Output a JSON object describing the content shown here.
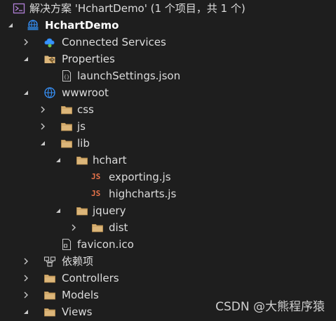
{
  "solution": {
    "title": "解决方案 'HchartDemo' (1 个项目，共 1 个)"
  },
  "project": {
    "name": "HchartDemo"
  },
  "items": {
    "connected_services": "Connected Services",
    "properties": "Properties",
    "launch_settings": "launchSettings.json",
    "wwwroot": "wwwroot",
    "css": "css",
    "js": "js",
    "lib": "lib",
    "hchart": "hchart",
    "exporting": "exporting.js",
    "highcharts": "highcharts.js",
    "jquery": "jquery",
    "dist": "dist",
    "favicon": "favicon.ico",
    "dependencies": "依赖项",
    "controllers": "Controllers",
    "models": "Models",
    "views": "Views"
  },
  "icons": {
    "js_badge": "JS"
  },
  "colors": {
    "background": "#1e1e1e",
    "folder": "#dcb67a",
    "js_badge": "#e8734a",
    "globe": "#3794ff",
    "solution": "#b180d7"
  },
  "watermark": "CSDN @大熊程序猿"
}
